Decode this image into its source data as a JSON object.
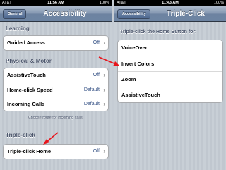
{
  "left": {
    "status": {
      "carrier": "AT&T",
      "time": "11:56 AM",
      "battery": "100%"
    },
    "nav": {
      "back": "General",
      "title": "Accessibility"
    },
    "learning": {
      "header": "Learning",
      "rows": [
        {
          "label": "Guided Access",
          "value": "Off"
        }
      ]
    },
    "physical": {
      "header": "Physical & Motor",
      "rows": [
        {
          "label": "AssistiveTouch",
          "value": "Off"
        },
        {
          "label": "Home-click Speed",
          "value": "Default"
        },
        {
          "label": "Incoming Calls",
          "value": "Default"
        }
      ],
      "footer": "Choose route for incoming calls."
    },
    "triple": {
      "header": "Triple-click",
      "rows": [
        {
          "label": "Triple-click Home",
          "value": "Off"
        }
      ]
    }
  },
  "right": {
    "status": {
      "carrier": "AT&T",
      "time": "11:43 AM",
      "battery": "100%"
    },
    "nav": {
      "back": "Accessibility",
      "title": "Triple-Click"
    },
    "section": {
      "header": "Triple-click the Home Button for:",
      "options": [
        "VoiceOver",
        "Invert Colors",
        "Zoom",
        "AssistiveTouch"
      ]
    }
  },
  "colors": {
    "annotation_arrow": "#e8141b",
    "navbar": "#6d84a2",
    "value_text": "#385487"
  }
}
